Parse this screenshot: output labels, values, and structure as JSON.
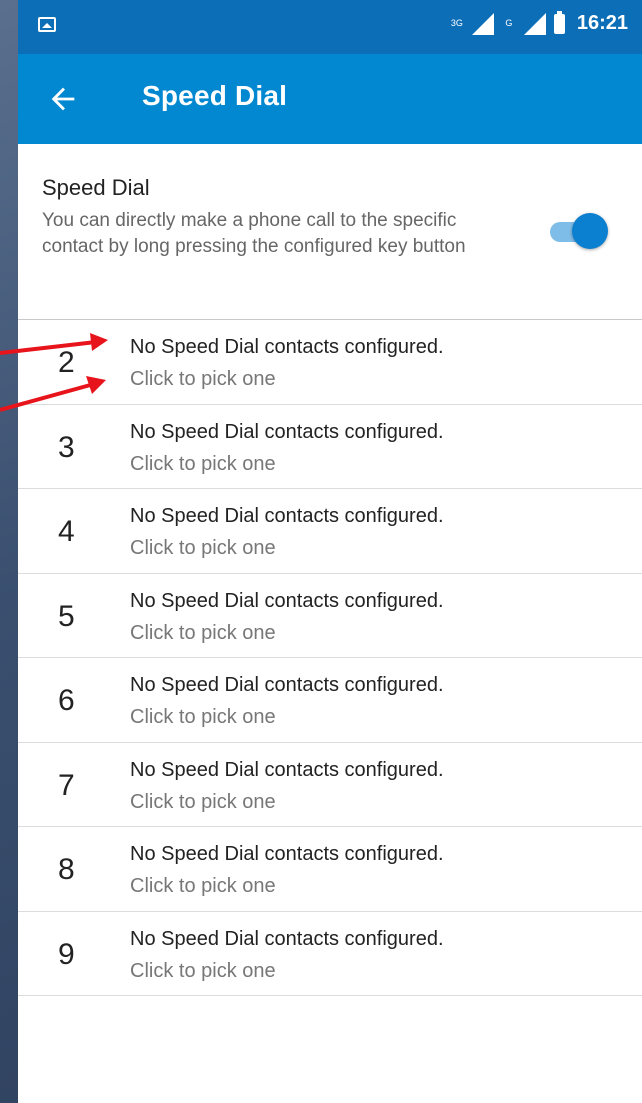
{
  "status_bar": {
    "network_label": "3G",
    "network_label2": "G",
    "time": "16:21"
  },
  "app_bar": {
    "title": "Speed Dial",
    "back_icon": "arrow-left-icon"
  },
  "setting": {
    "title": "Speed Dial",
    "description": "You can directly make a phone call to the specific contact by long pressing the configured key button",
    "toggle_on": true,
    "accent_color": "#0b7fd0"
  },
  "rows": [
    {
      "key": "2",
      "title": "No Speed Dial contacts configured.",
      "subtitle": "Click to pick one"
    },
    {
      "key": "3",
      "title": "No Speed Dial contacts configured.",
      "subtitle": "Click to pick one"
    },
    {
      "key": "4",
      "title": "No Speed Dial contacts configured.",
      "subtitle": "Click to pick one"
    },
    {
      "key": "5",
      "title": "No Speed Dial contacts configured.",
      "subtitle": "Click to pick one"
    },
    {
      "key": "6",
      "title": "No Speed Dial contacts configured.",
      "subtitle": "Click to pick one"
    },
    {
      "key": "7",
      "title": "No Speed Dial contacts configured.",
      "subtitle": "Click to pick one"
    },
    {
      "key": "8",
      "title": "No Speed Dial contacts configured.",
      "subtitle": "Click to pick one"
    },
    {
      "key": "9",
      "title": "No Speed Dial contacts configured.",
      "subtitle": "Click to pick one"
    }
  ],
  "colors": {
    "status_bar": "#0d6eb8",
    "app_bar": "#0288d1",
    "annotation_arrow": "#e8141b"
  }
}
